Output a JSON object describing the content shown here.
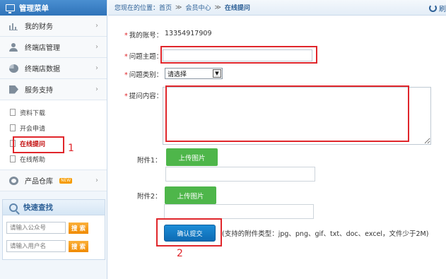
{
  "sidebar": {
    "title": "管理菜单",
    "items": [
      {
        "label": "我的财务",
        "icon": "finance-icon"
      },
      {
        "label": "终端店管理",
        "icon": "user-icon"
      },
      {
        "label": "终端店数据",
        "icon": "pie-icon"
      },
      {
        "label": "服务支持",
        "icon": "tag-icon"
      }
    ],
    "sub_items": [
      {
        "label": "资料下载"
      },
      {
        "label": "开会申请"
      },
      {
        "label": "在线提问",
        "active": true
      },
      {
        "label": "在线帮助"
      }
    ],
    "product_item": {
      "label": "产品仓库",
      "badge": "NEW"
    },
    "marker_1": "1"
  },
  "quick_search": {
    "title": "快速查找",
    "public_placeholder": "请输入公众号",
    "user_placeholder": "请输入用户名",
    "button_label": "搜 索"
  },
  "breadcrumb": {
    "prefix": "您现在的位置：",
    "home": "首页",
    "separator": "≫",
    "member": "会员中心",
    "current": "在线提问"
  },
  "refresh_label": "刷",
  "form": {
    "account_label": "我的账号：",
    "account_value": "13354917909",
    "topic_label": "问题主题：",
    "topic_value": "",
    "category_label": "问题类别：",
    "category_selected": "请选择",
    "content_label": "提问内容：",
    "content_value": "",
    "attachment1_label": "附件1：",
    "attachment2_label": "附件2：",
    "upload_label": "上传图片",
    "submit_label": "确认提交",
    "hint": "(支持的附件类型：jpg、png、gif、txt、doc、excel，文件少于2M)",
    "marker_2": "2"
  },
  "colors": {
    "accent": "#2f73b9",
    "highlight": "#e0262b",
    "upload": "#4eb64a",
    "submit": "#0d6bb4"
  }
}
